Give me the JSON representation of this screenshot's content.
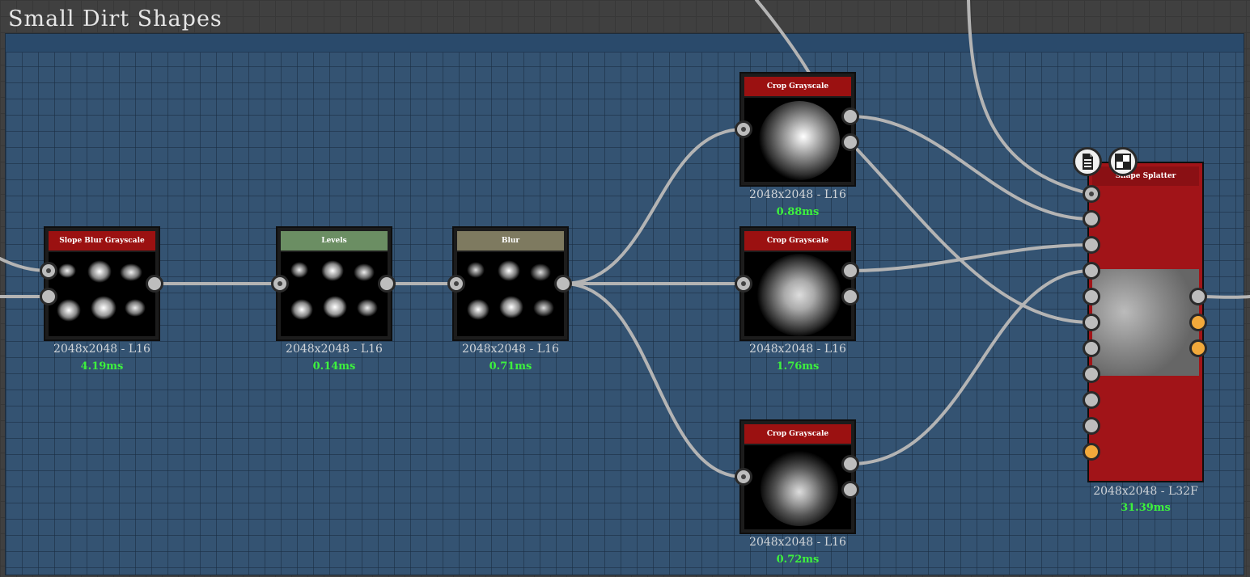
{
  "frame": {
    "title": "Small Dirt Shapes"
  },
  "nodes": [
    {
      "id": "slope-blur",
      "title": "Slope Blur Grayscale",
      "resolution": "2048x2048 - L16",
      "time": "4.19ms",
      "color": "#9b1111"
    },
    {
      "id": "levels",
      "title": "Levels",
      "resolution": "2048x2048 - L16",
      "time": "0.14ms",
      "color": "#6b8e63"
    },
    {
      "id": "blur",
      "title": "Blur",
      "resolution": "2048x2048 - L16",
      "time": "0.71ms",
      "color": "#7e7a60"
    },
    {
      "id": "crop-1",
      "title": "Crop Grayscale",
      "resolution": "2048x2048 - L16",
      "time": "0.88ms",
      "color": "#9b1111"
    },
    {
      "id": "crop-2",
      "title": "Crop Grayscale",
      "resolution": "2048x2048 - L16",
      "time": "1.76ms",
      "color": "#9b1111"
    },
    {
      "id": "crop-3",
      "title": "Crop Grayscale",
      "resolution": "2048x2048 - L16",
      "time": "0.72ms",
      "color": "#9b1111"
    },
    {
      "id": "shape-splatter",
      "title": "Shape Splatter",
      "resolution": "2048x2048 - L32F",
      "time": "31.39ms",
      "color": "#a11418"
    }
  ],
  "icons": {
    "doc": "document-icon",
    "checker": "checker-icon"
  },
  "colors": {
    "link": "#b4b4b4",
    "time_text": "#3df23d",
    "port_orange": "#f2a93b"
  }
}
